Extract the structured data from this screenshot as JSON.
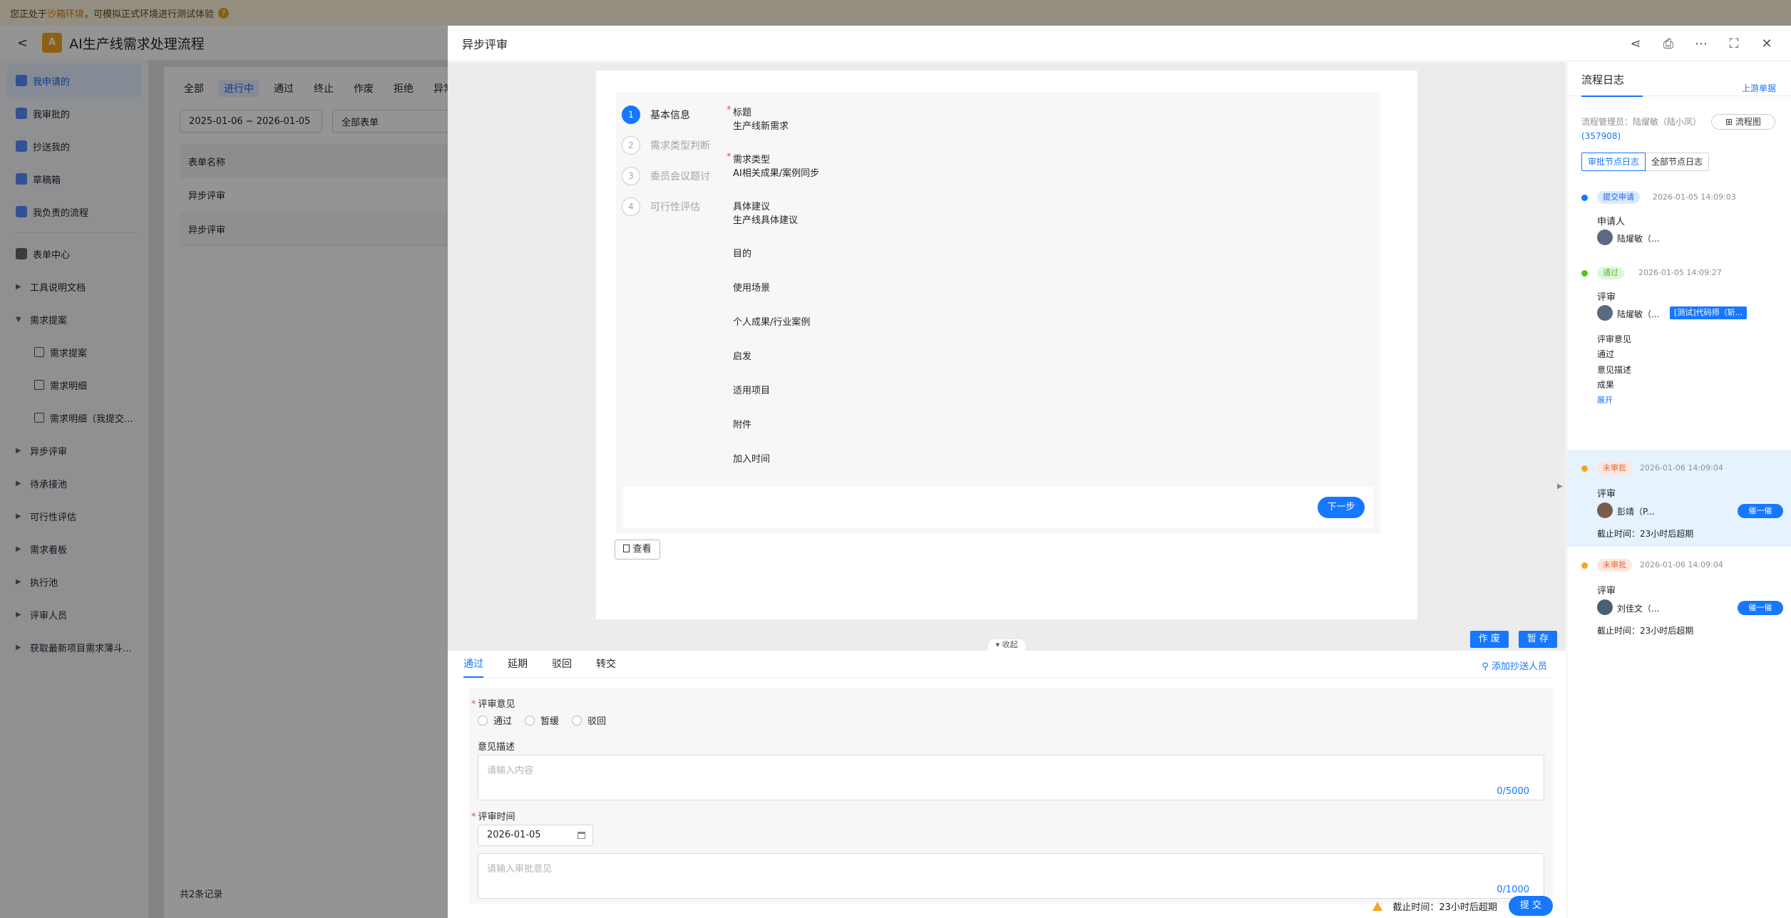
{
  "banner": {
    "text_pre": "您正处于",
    "text_hl": "沙箱环境",
    "text_post": "，可模拟正式环境进行测试体验",
    "help_icon": "?"
  },
  "app": {
    "back_icon": "<",
    "logo": "A",
    "title": "AI生产线需求处理流程"
  },
  "sidebar": {
    "items": [
      {
        "label": "我申请的"
      },
      {
        "label": "我审批的"
      },
      {
        "label": "抄送我的"
      },
      {
        "label": "草稿箱"
      },
      {
        "label": "我负责的流程"
      },
      {
        "label": "表单中心"
      },
      {
        "label": "工具说明文档"
      },
      {
        "label": "需求提案"
      },
      {
        "label": "需求提案"
      },
      {
        "label": "需求明细"
      },
      {
        "label": "需求明细（我提交..."
      },
      {
        "label": "异步评审"
      },
      {
        "label": "待承接池"
      },
      {
        "label": "可行性评估"
      },
      {
        "label": "需求看板"
      },
      {
        "label": "执行池"
      },
      {
        "label": "评审人员"
      },
      {
        "label": "获取最新项目需求薄斗..."
      }
    ]
  },
  "list": {
    "tabs": [
      "全部",
      "进行中",
      "通过",
      "终止",
      "作废",
      "拒绝",
      "异常"
    ],
    "date_range": "2025-01-06 ~ 2026-01-05",
    "form_filter": "全部表单",
    "column": "表单名称",
    "rows": [
      "异步评审",
      "异步评审"
    ],
    "total": "共2条记录"
  },
  "drawer": {
    "title": "异步评审",
    "steps": [
      {
        "num": "1",
        "label": "基本信息"
      },
      {
        "num": "2",
        "label": "需求类型判断"
      },
      {
        "num": "3",
        "label": "委员会议题讨"
      },
      {
        "num": "4",
        "label": "可行性评估"
      }
    ],
    "fields": [
      {
        "label": "标题",
        "value": "生产线新需求"
      },
      {
        "label": "需求类型",
        "value": "AI相关成果/案例同步"
      },
      {
        "label": "具体建议",
        "value": "生产线具体建议"
      },
      {
        "label": "目的"
      },
      {
        "label": "使用场景"
      },
      {
        "label": "个人成果/行业案例"
      },
      {
        "label": "启发"
      },
      {
        "label": "适用项目"
      },
      {
        "label": "附件"
      },
      {
        "label": "加入时间"
      }
    ],
    "next_button": "下一步",
    "view_button": "查看",
    "void_button": "作 废",
    "save_button": "暂 存",
    "collapse": "收起"
  },
  "review": {
    "tabs": [
      "通过",
      "延期",
      "驳回",
      "转交"
    ],
    "add_cc": "添加抄送人员",
    "opinion_label": "评审意见",
    "options": [
      "通过",
      "暂缓",
      "驳回"
    ],
    "desc_label": "意见描述",
    "desc_placeholder": "请输入内容",
    "desc_count": "0/5000",
    "time_label": "评审时间",
    "time_value": "2026-01-05",
    "comment_placeholder": "请输入审批意见",
    "comment_count": "0/1000",
    "deadline": "截止时间：23小时后超期",
    "submit": "提 交"
  },
  "log": {
    "tab": "流程日志",
    "upstream": "上游单据",
    "manager": "流程管理员：陆燿敏（陆小凤）",
    "manager_id": "(357908)",
    "flow_chart": "流程图",
    "seg_on": "审批节点日志",
    "seg_off": "全部节点日志",
    "nodes": [
      {
        "tag": "提交申请",
        "time": "2026-01-05 14:09:03",
        "role": "申请人",
        "person": "陆燿敏（..."
      },
      {
        "tag": "通过",
        "time": "2026-01-05 14:09:27",
        "role": "评审",
        "person": "陆燿敏（...",
        "agent": "[测试]代码师（斩...",
        "op_label": "评审意见",
        "op_value": "通过",
        "desc_label": "意见描述",
        "desc_value": "成果",
        "expand": "展开"
      },
      {
        "tag": "未审批",
        "time": "2026-01-06 14:09:04",
        "role": "评审",
        "person": "彭靖（P...",
        "urge": "催一催",
        "deadline": "截止时间：23小时后超期"
      },
      {
        "tag": "未审批",
        "time": "2026-01-06 14:09:04",
        "role": "评审",
        "person": "刘佳文（...",
        "urge": "催一催",
        "deadline": "截止时间：23小时后超期"
      }
    ]
  },
  "colors": {
    "primary": "#1677ff",
    "required": "#e34d59",
    "warning": "#f5a623"
  }
}
